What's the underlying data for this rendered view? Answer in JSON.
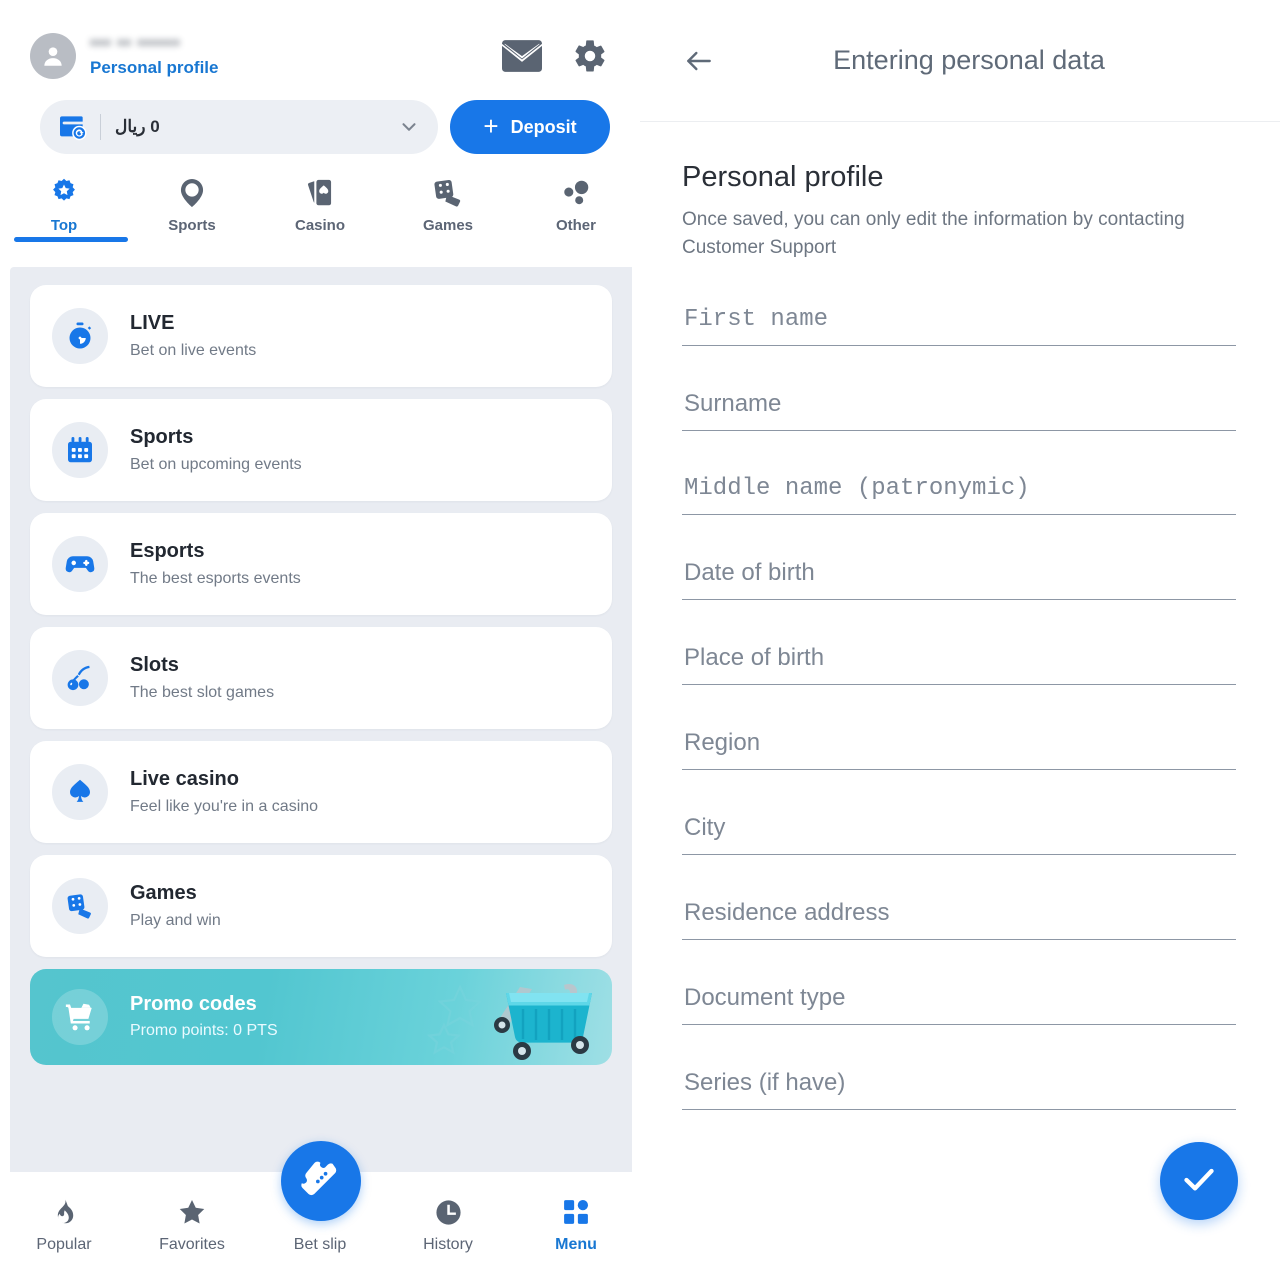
{
  "left": {
    "account": {
      "user_id": "••• •• ••••••",
      "profile_link": "Personal profile",
      "mail_icon": "mail-icon",
      "settings_icon": "gear-icon"
    },
    "balance": {
      "wallet_icon": "wallet-refresh-icon",
      "amount": "0 ريال",
      "chevron_icon": "chevron-down-icon",
      "deposit_label": "Deposit",
      "deposit_plus": "+"
    },
    "category_tabs": [
      {
        "label": "Top",
        "icon": "star-badge-icon",
        "active": true
      },
      {
        "label": "Sports",
        "icon": "soccer-pin-icon",
        "active": false
      },
      {
        "label": "Casino",
        "icon": "playing-cards-icon",
        "active": false
      },
      {
        "label": "Games",
        "icon": "dice-cards-icon",
        "active": false
      },
      {
        "label": "Other",
        "icon": "dots-cluster-icon",
        "active": false
      }
    ],
    "menu_items": [
      {
        "title": "LIVE",
        "subtitle": "Bet on live events",
        "icon": "stopwatch-icon"
      },
      {
        "title": "Sports",
        "subtitle": "Bet on upcoming events",
        "icon": "calendar-icon"
      },
      {
        "title": "Esports",
        "subtitle": "The best esports events",
        "icon": "gamepad-icon"
      },
      {
        "title": "Slots",
        "subtitle": "The best slot games",
        "icon": "cherries-icon"
      },
      {
        "title": "Live casino",
        "subtitle": "Feel like you're in a casino",
        "icon": "spade-icon"
      },
      {
        "title": "Games",
        "subtitle": "Play and win",
        "icon": "dice-icon"
      }
    ],
    "promo": {
      "title": "Promo codes",
      "subtitle": "Promo points: 0 PTS",
      "icon": "shopping-cart-icon",
      "art": "shopping-basket-cart-illustration"
    },
    "bottom_nav": [
      {
        "label": "Popular",
        "icon": "flame-icon",
        "active": false
      },
      {
        "label": "Favorites",
        "icon": "star-icon",
        "active": false
      },
      {
        "label": "Bet slip",
        "icon": "ticket-icon",
        "active": false
      },
      {
        "label": "History",
        "icon": "clock-icon",
        "active": false
      },
      {
        "label": "Menu",
        "icon": "grid-icon",
        "active": true
      }
    ]
  },
  "right": {
    "appbar": {
      "back_icon": "arrow-left-icon",
      "title": "Entering personal data"
    },
    "heading": "Personal profile",
    "note": "Once saved, you can only edit the information by contacting Customer Support",
    "fields": [
      {
        "placeholder": "First name",
        "value": "",
        "mono": true
      },
      {
        "placeholder": "Surname",
        "value": "",
        "mono": false
      },
      {
        "placeholder": "Middle name (patronymic)",
        "value": "",
        "mono": true
      },
      {
        "placeholder": "Date of birth",
        "value": "",
        "mono": false
      },
      {
        "placeholder": "Place of birth",
        "value": "",
        "mono": false
      },
      {
        "placeholder": "Region",
        "value": "",
        "mono": false
      },
      {
        "placeholder": "City",
        "value": "",
        "mono": false
      },
      {
        "placeholder": "Residence address",
        "value": "",
        "mono": false
      },
      {
        "placeholder": "Document type",
        "value": "",
        "mono": false
      },
      {
        "placeholder": "Series (if have)",
        "value": "",
        "mono": false
      }
    ],
    "submit": {
      "icon": "check-icon"
    }
  },
  "colors": {
    "accent_blue": "#1877e8",
    "link_blue": "#1877d2",
    "slate": "#5c6575",
    "page_bg": "#e9ecf2",
    "promo_teal": "#52c6d0"
  }
}
